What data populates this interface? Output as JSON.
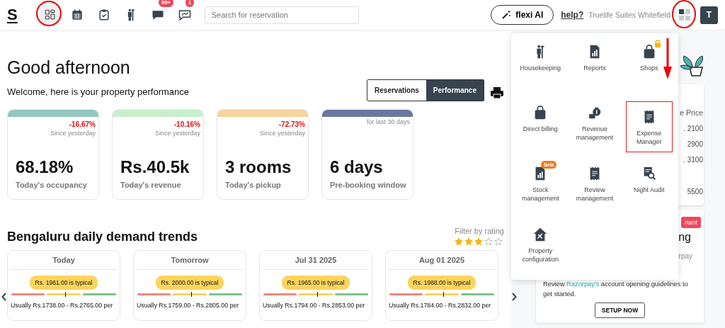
{
  "header": {
    "logo": "S",
    "nav_icons": [
      {
        "circled": true
      },
      {
        "circled": false
      },
      {
        "circled": false
      },
      {
        "circled": false
      },
      {
        "badge": "99+",
        "circled": false
      },
      {
        "badge": "1",
        "circled": false
      }
    ],
    "search": {
      "placeholder": "Search for reservation"
    },
    "ai_button": "flexi AI",
    "help_link": "help?",
    "property": "Truelife Suites Whitefield",
    "apps_circled": true,
    "avatar": "T"
  },
  "greeting": "Good afternoon",
  "welcome": "Welcome, here is your property performance",
  "view_toggle": [
    {
      "label": "Reservations",
      "selected": false
    },
    {
      "label": "Performance",
      "selected": true
    }
  ],
  "kpis": [
    {
      "color": "#94c7c0",
      "change": "-16.67%",
      "note": "Since yesterday",
      "value": "68.18%",
      "label": "Today's occupancy"
    },
    {
      "color": "#c8f0cc",
      "change": "-10.16%",
      "note": "Since yesterday",
      "value": "Rs.40.5k",
      "label": "Today's revenue"
    },
    {
      "color": "#f6d49c",
      "change": "-72.73%",
      "note": "Since yesterday",
      "value": "3 rooms",
      "label": "Today's pickup"
    },
    {
      "color": "#6b779e",
      "note": "for last 30 days",
      "value": "6 days",
      "label": "Pre-booking window"
    }
  ],
  "demand": {
    "title": "Bengaluru daily demand trends",
    "filter_label": "Filter by rating",
    "stars": 3,
    "days": [
      {
        "day": "Today",
        "typical": "Rs. 1961.00 is typical",
        "range": "Usually Rs.1738.00 - Rs.2765.00 per"
      },
      {
        "day": "Tomorrow",
        "typical": "Rs. 2000.00 is typical",
        "range": "Usually Rs.1759.00 - Rs.2805.00 per"
      },
      {
        "day": "Jul 31 2025",
        "typical": "Rs. 1965.00 is typical",
        "range": "Usually Rs.1794.00 - Rs.2853.00 per"
      },
      {
        "day": "Aug 01 2025",
        "typical": "Rs. 1988.00 is typical",
        "range": "Usually Rs.1784.00 - Rs.2832.00 per"
      }
    ]
  },
  "side_panel": {
    "price_header": "e Price",
    "prices": [
      ". 2100",
      "2900",
      ". 3100",
      "5500"
    ],
    "tag": "rtant",
    "title": "ng",
    "subtitle": "rpay",
    "text_before": "Review ",
    "link": "Razorpay's",
    "text_after": " account opening guidelines to get started.",
    "button": "SETUP NOW"
  },
  "apps_menu": [
    {
      "label": "Housekeeping",
      "locked": false,
      "highlighted": false
    },
    {
      "label": "Reports",
      "locked": false,
      "highlighted": false
    },
    {
      "label": "Shops",
      "locked": true,
      "highlighted": false
    },
    {
      "label": "Direct billing",
      "locked": false,
      "highlighted": false
    },
    {
      "label": "Revenue management",
      "locked": false,
      "highlighted": false
    },
    {
      "label": "Expense Manager",
      "locked": false,
      "highlighted": true
    },
    {
      "label": "Stock management",
      "badge": "Beta",
      "locked": false,
      "highlighted": false
    },
    {
      "label": "Review management",
      "locked": false,
      "highlighted": false
    },
    {
      "label": "Night Audit",
      "locked": false,
      "highlighted": false
    },
    {
      "label": "Property configuration",
      "locked": false,
      "highlighted": false
    }
  ]
}
